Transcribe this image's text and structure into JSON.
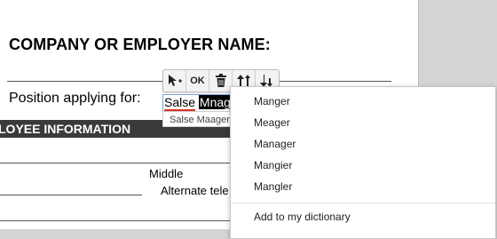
{
  "form": {
    "company_label": "COMPANY OR EMPLOYER NAME:",
    "position_label": "Position applying for:",
    "section_title": "LOYEE INFORMATION",
    "middle_label": "Middle",
    "alternate_label": "Alternate tele"
  },
  "field": {
    "word1": "Salse",
    "word2": "Mnag",
    "suggestion_preview": "Salse Maager"
  },
  "toolbar": {
    "ok_label": "OK",
    "icons": [
      "move-icon",
      "delete-icon",
      "increase-size-icon",
      "decrease-size-icon"
    ]
  },
  "context_menu": {
    "suggestions": [
      "Manger",
      "Meager",
      "Manager",
      "Mangier",
      "Mangler"
    ],
    "add_to_dictionary": "Add to my dictionary"
  }
}
